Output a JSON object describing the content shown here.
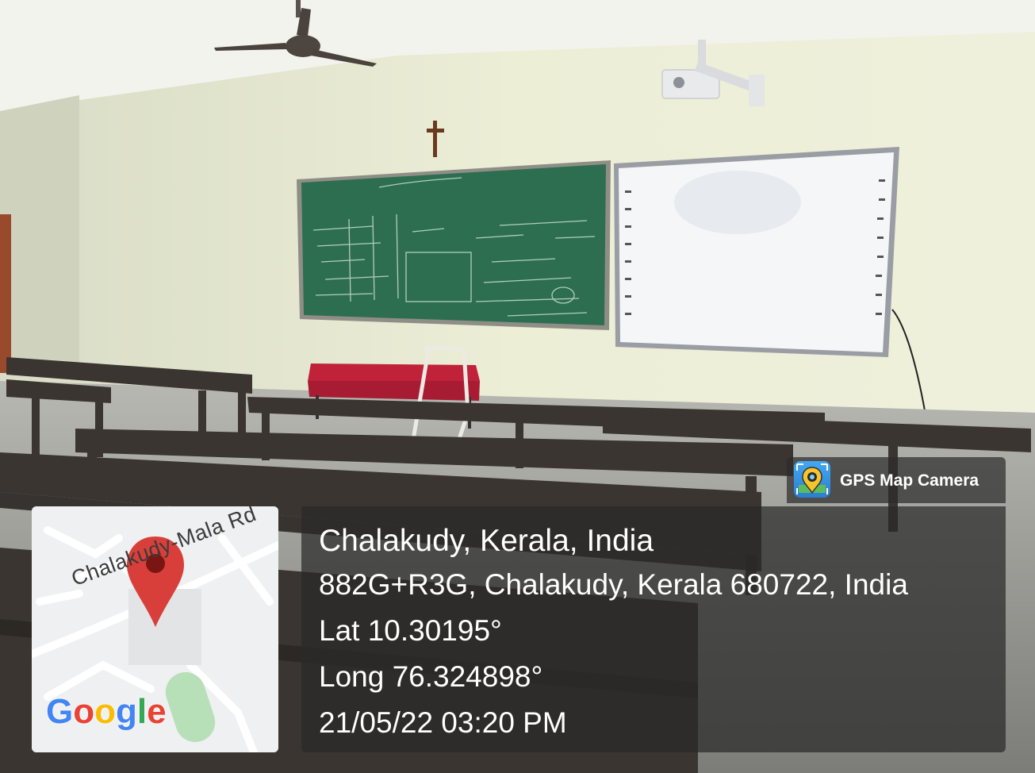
{
  "scene": {
    "description_colors": {
      "wall": "#e9ead2",
      "chalkboard": "#2e6e50",
      "whiteboard": "#f4f6f8",
      "desk": "#3a3530",
      "floor": "#9c9c98",
      "tablecloth": "#c0223a"
    }
  },
  "map": {
    "road_label": "Chalakudy-Mala Rd",
    "pin_color": "#d93f3a",
    "logo": {
      "text": "Google",
      "colors": [
        "#4285F4",
        "#EA4335",
        "#FBBC05",
        "#4285F4",
        "#34A853",
        "#EA4335"
      ]
    }
  },
  "app_badge": {
    "name": "GPS Map Camera",
    "icon": "map-pin-camera-icon"
  },
  "location": {
    "title": "Chalakudy, Kerala, India",
    "address": "882G+R3G, Chalakudy, Kerala 680722, India",
    "lat": "Lat 10.30195°",
    "long": "Long 76.324898°",
    "timestamp": "21/05/22 03:20 PM"
  }
}
